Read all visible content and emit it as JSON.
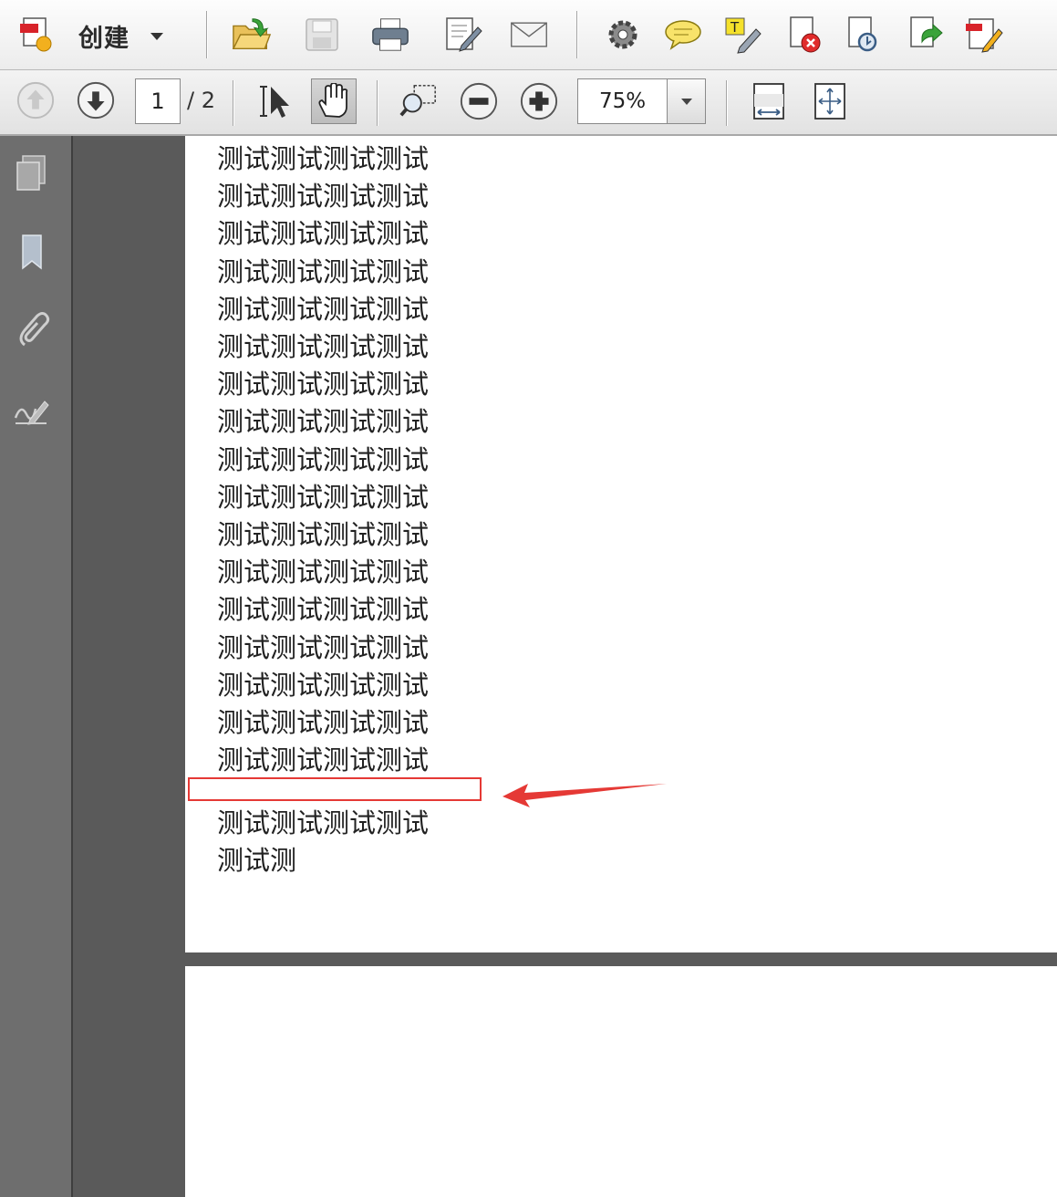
{
  "toolbar": {
    "create_label": "创建",
    "icons": [
      "create-pdf-icon",
      "open-folder-icon",
      "save-icon",
      "print-icon",
      "edit-icon",
      "email-icon",
      "gear-icon",
      "comment-icon",
      "highlight-text-icon",
      "delete-pdf-icon",
      "export-icon",
      "share-icon",
      "sign-edit-icon"
    ]
  },
  "navigation": {
    "current_page": "1",
    "total_pages": "/ 2",
    "zoom": "75%"
  },
  "document": {
    "page1_lines": [
      "测试测试测试测试",
      "测试测试测试测试",
      "测试测试测试测试",
      "测试测试测试测试",
      "测试测试测试测试",
      "测试测试测试测试",
      "测试测试测试测试",
      "测试测试测试测试",
      "测试测试测试测试",
      "测试测试测试测试",
      "测试测试测试测试",
      "测试测试测试测试",
      "测试测试测试测试",
      "测试测试测试测试",
      "测试测试测试测试",
      "测试测试测试测试",
      "测试测试测试测试"
    ],
    "page1_after_gap": [
      "测试测试测试测试",
      "测试测"
    ]
  },
  "colors": {
    "annotation": "#e53935"
  }
}
